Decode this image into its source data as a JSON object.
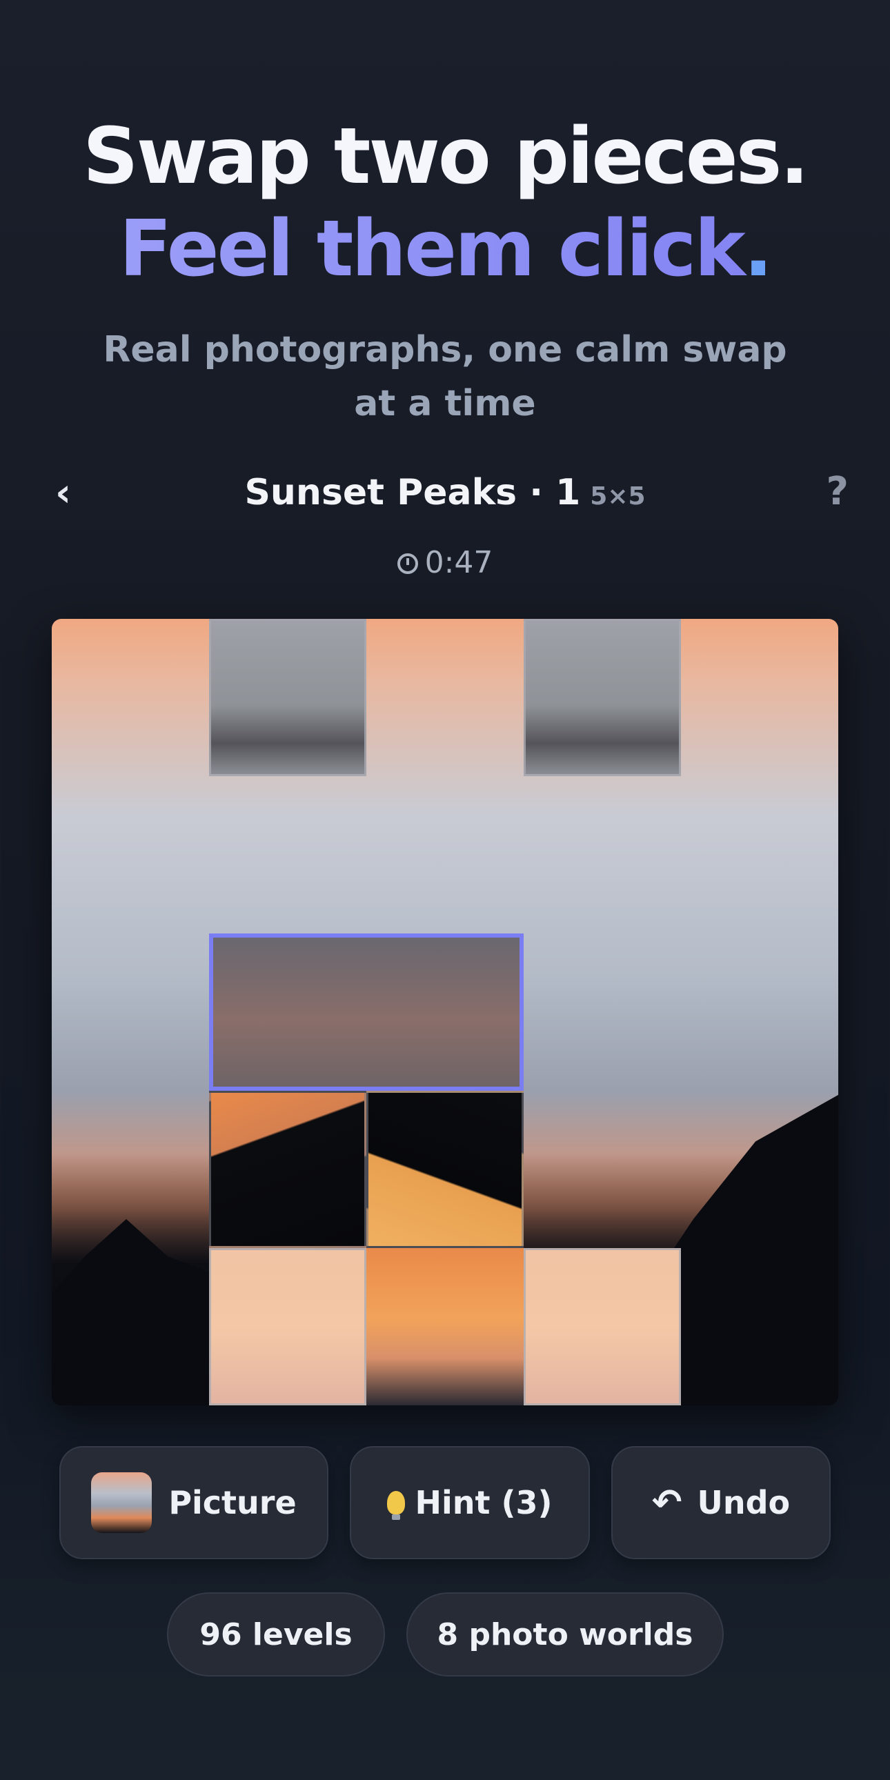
{
  "hero": {
    "line1": "Swap two pieces.",
    "line2": "Feel them click",
    "line2_dot": ".",
    "subtitle": "Real photographs, one calm swap at a time"
  },
  "level": {
    "back_icon": "‹",
    "title": "Sunset Peaks · 1",
    "grid_size": "5×5",
    "help_icon": "?"
  },
  "timer": {
    "icon": "stopwatch-icon",
    "value": "0:47"
  },
  "board": {
    "grid": 5,
    "selected_piece": "row 3, columns 2–3"
  },
  "buttons": {
    "picture": "Picture",
    "hint": "Hint (3)",
    "undo": "Undo"
  },
  "stats": {
    "levels": "96 levels",
    "worlds": "8 photo worlds"
  },
  "colors": {
    "accent": "#8c8cf5",
    "selection_border": "#7a7ef2",
    "background": "#161a24",
    "button_bg": "#262b36"
  }
}
